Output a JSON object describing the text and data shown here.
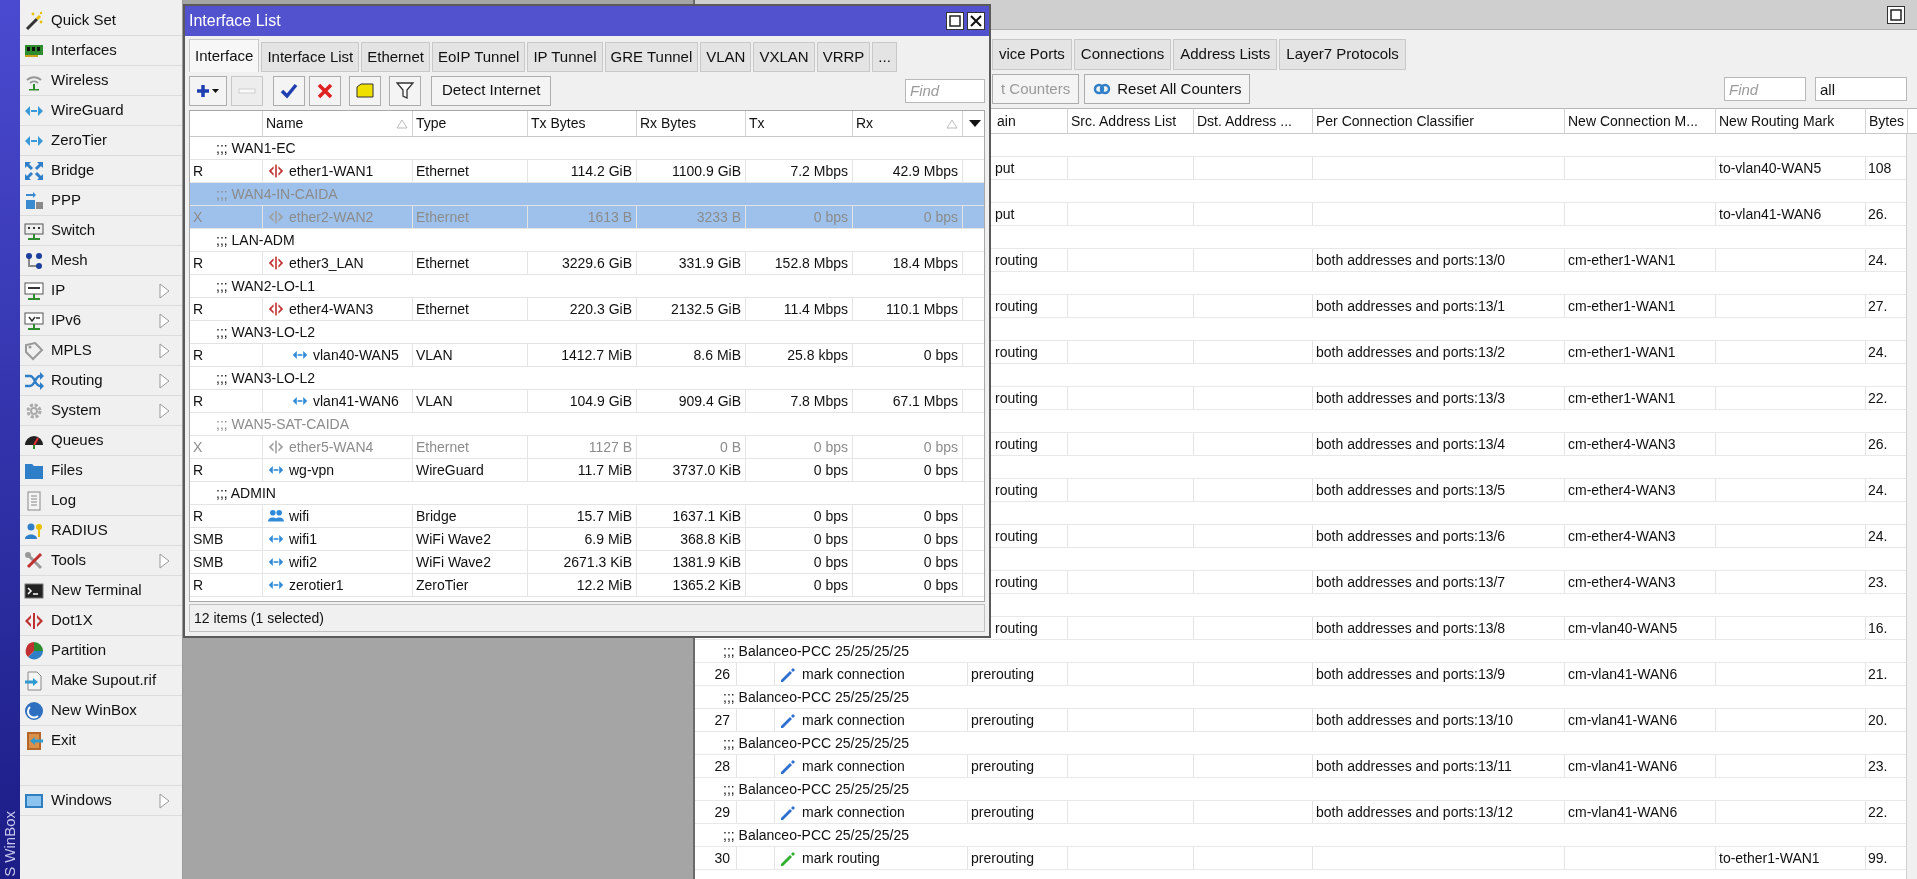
{
  "sidebar": {
    "caption": "S WinBox",
    "items": [
      {
        "label": "Quick Set",
        "submenu": false
      },
      {
        "label": "Interfaces",
        "submenu": false
      },
      {
        "label": "Wireless",
        "submenu": false
      },
      {
        "label": "WireGuard",
        "submenu": false
      },
      {
        "label": "ZeroTier",
        "submenu": false
      },
      {
        "label": "Bridge",
        "submenu": false
      },
      {
        "label": "PPP",
        "submenu": false
      },
      {
        "label": "Switch",
        "submenu": false
      },
      {
        "label": "Mesh",
        "submenu": false
      },
      {
        "label": "IP",
        "submenu": true
      },
      {
        "label": "IPv6",
        "submenu": true
      },
      {
        "label": "MPLS",
        "submenu": true
      },
      {
        "label": "Routing",
        "submenu": true
      },
      {
        "label": "System",
        "submenu": true
      },
      {
        "label": "Queues",
        "submenu": false
      },
      {
        "label": "Files",
        "submenu": false
      },
      {
        "label": "Log",
        "submenu": false
      },
      {
        "label": "RADIUS",
        "submenu": false
      },
      {
        "label": "Tools",
        "submenu": true
      },
      {
        "label": "New Terminal",
        "submenu": false
      },
      {
        "label": "Dot1X",
        "submenu": false
      },
      {
        "label": "Partition",
        "submenu": false
      },
      {
        "label": "Make Supout.rif",
        "submenu": false
      },
      {
        "label": "New WinBox",
        "submenu": false
      },
      {
        "label": "Exit",
        "submenu": false
      }
    ],
    "windows_item": {
      "label": "Windows",
      "submenu": true
    }
  },
  "rules_window": {
    "tabs": [
      {
        "label": "vice Ports",
        "selected": false
      },
      {
        "label": "Connections",
        "selected": false
      },
      {
        "label": "Address Lists",
        "selected": false
      },
      {
        "label": "Layer7 Protocols",
        "selected": false
      }
    ],
    "buttons": [
      {
        "label": "t Counters",
        "disabled": true
      },
      {
        "label": "Reset All Counters",
        "disabled": false
      }
    ],
    "find_placeholder": "Find",
    "filter_value": "all",
    "columns": [
      "ain",
      "Src. Address List",
      "Dst. Address ...",
      "Per Connection Classifier",
      "New Connection M...",
      "New Routing Mark",
      "Bytes"
    ],
    "rows": [
      {
        "kind": "comment"
      },
      {
        "kind": "rule",
        "chain": "put",
        "routing_mark": "to-vlan40-WAN5",
        "bytes": "108"
      },
      {
        "kind": "comment"
      },
      {
        "kind": "rule",
        "chain": "put",
        "routing_mark": "to-vlan41-WAN6",
        "bytes": "26."
      },
      {
        "kind": "comment"
      },
      {
        "kind": "rule",
        "chain": "routing",
        "classifier": "both addresses and ports:13/0",
        "connection_mark": "cm-ether1-WAN1",
        "bytes": "24."
      },
      {
        "kind": "comment"
      },
      {
        "kind": "rule",
        "chain": "routing",
        "classifier": "both addresses and ports:13/1",
        "connection_mark": "cm-ether1-WAN1",
        "bytes": "27."
      },
      {
        "kind": "comment"
      },
      {
        "kind": "rule",
        "chain": "routing",
        "classifier": "both addresses and ports:13/2",
        "connection_mark": "cm-ether1-WAN1",
        "bytes": "24."
      },
      {
        "kind": "comment"
      },
      {
        "kind": "rule",
        "chain": "routing",
        "classifier": "both addresses and ports:13/3",
        "connection_mark": "cm-ether1-WAN1",
        "bytes": "22."
      },
      {
        "kind": "comment"
      },
      {
        "kind": "rule",
        "chain": "routing",
        "classifier": "both addresses and ports:13/4",
        "connection_mark": "cm-ether4-WAN3",
        "bytes": "26."
      },
      {
        "kind": "comment"
      },
      {
        "kind": "rule",
        "chain": "routing",
        "classifier": "both addresses and ports:13/5",
        "connection_mark": "cm-ether4-WAN3",
        "bytes": "24."
      },
      {
        "kind": "comment"
      },
      {
        "kind": "rule",
        "chain": "routing",
        "classifier": "both addresses and ports:13/6",
        "connection_mark": "cm-ether4-WAN3",
        "bytes": "24."
      },
      {
        "kind": "comment"
      },
      {
        "kind": "rule",
        "chain": "routing",
        "classifier": "both addresses and ports:13/7",
        "connection_mark": "cm-ether4-WAN3",
        "bytes": "23."
      },
      {
        "kind": "comment"
      },
      {
        "kind": "rule",
        "chain": "routing",
        "classifier": "both addresses and ports:13/8",
        "connection_mark": "cm-vlan40-WAN5",
        "bytes": "16."
      },
      {
        "kind": "comment",
        "text": ";;; Balanceo-PCC 25/25/25/25"
      },
      {
        "kind": "rule",
        "number": "26",
        "action": "mark connection",
        "color": "#2f6fd0",
        "chain": "prerouting",
        "classifier": "both addresses and ports:13/9",
        "connection_mark": "cm-vlan41-WAN6",
        "bytes": "21."
      },
      {
        "kind": "comment",
        "text": ";;; Balanceo-PCC 25/25/25/25"
      },
      {
        "kind": "rule",
        "number": "27",
        "action": "mark connection",
        "color": "#2f6fd0",
        "chain": "prerouting",
        "classifier": "both addresses and ports:13/10",
        "connection_mark": "cm-vlan41-WAN6",
        "bytes": "20."
      },
      {
        "kind": "comment",
        "text": ";;; Balanceo-PCC 25/25/25/25"
      },
      {
        "kind": "rule",
        "number": "28",
        "action": "mark connection",
        "color": "#2f6fd0",
        "chain": "prerouting",
        "classifier": "both addresses and ports:13/11",
        "connection_mark": "cm-vlan41-WAN6",
        "bytes": "23."
      },
      {
        "kind": "comment",
        "text": ";;; Balanceo-PCC 25/25/25/25"
      },
      {
        "kind": "rule",
        "number": "29",
        "action": "mark connection",
        "color": "#2f6fd0",
        "chain": "prerouting",
        "classifier": "both addresses and ports:13/12",
        "connection_mark": "cm-vlan41-WAN6",
        "bytes": "22."
      },
      {
        "kind": "comment",
        "text": ";;; Balanceo-PCC 25/25/25/25"
      },
      {
        "kind": "rule",
        "number": "30",
        "action": "mark routing",
        "color": "#2fb02f",
        "chain": "prerouting",
        "routing_mark": "to-ether1-WAN1",
        "bytes": "99."
      }
    ]
  },
  "interface_window": {
    "title": "Interface List",
    "tabs": [
      {
        "label": "Interface",
        "selected": true
      },
      {
        "label": "Interface List",
        "selected": false
      },
      {
        "label": "Ethernet",
        "selected": false
      },
      {
        "label": "EoIP Tunnel",
        "selected": false
      },
      {
        "label": "IP Tunnel",
        "selected": false
      },
      {
        "label": "GRE Tunnel",
        "selected": false
      },
      {
        "label": "VLAN",
        "selected": false
      },
      {
        "label": "VXLAN",
        "selected": false
      },
      {
        "label": "VRRP",
        "selected": false
      },
      {
        "label": "...",
        "selected": false
      }
    ],
    "toolbar": [
      {
        "kind": "add",
        "disabled": false
      },
      {
        "kind": "remove",
        "disabled": true
      },
      {
        "kind": "enable",
        "disabled": false
      },
      {
        "kind": "disable",
        "disabled": false
      },
      {
        "kind": "comment",
        "disabled": false
      },
      {
        "kind": "filter",
        "disabled": false
      }
    ],
    "detect_button": "Detect Internet",
    "find_placeholder": "Find",
    "columns": [
      {
        "label": "Name",
        "sorted": true
      },
      {
        "label": "Type",
        "sorted": false
      },
      {
        "label": "Tx Bytes",
        "sorted": false
      },
      {
        "label": "Rx Bytes",
        "sorted": false
      },
      {
        "label": "Tx",
        "sorted": false
      },
      {
        "label": "Rx",
        "sorted": true
      }
    ],
    "items": [
      {
        "kind": "ethernet",
        "comment": ";;; WAN1-EC",
        "flags": "R",
        "name": "ether1-WAN1",
        "type": "Ethernet",
        "tx_bytes": "114.2 GiB",
        "rx_bytes": "1100.9 GiB",
        "tx": "7.2 Mbps",
        "rx": "42.9 Mbps",
        "disabled": false,
        "selected": false
      },
      {
        "kind": "ethernet",
        "comment": ";;; WAN4-IN-CAIDA",
        "flags": "X",
        "name": "ether2-WAN2",
        "type": "Ethernet",
        "tx_bytes": "1613 B",
        "rx_bytes": "3233 B",
        "tx": "0 bps",
        "rx": "0 bps",
        "disabled": true,
        "selected": true
      },
      {
        "kind": "ethernet",
        "comment": ";;; LAN-ADM",
        "flags": "R",
        "name": "ether3_LAN",
        "type": "Ethernet",
        "tx_bytes": "3229.6 GiB",
        "rx_bytes": "331.9 GiB",
        "tx": "152.8 Mbps",
        "rx": "18.4 Mbps",
        "disabled": false,
        "selected": false
      },
      {
        "kind": "ethernet",
        "comment": ";;; WAN2-LO-L1",
        "flags": "R",
        "name": "ether4-WAN3",
        "type": "Ethernet",
        "tx_bytes": "220.3 GiB",
        "rx_bytes": "2132.5 GiB",
        "tx": "11.4 Mbps",
        "rx": "110.1 Mbps",
        "disabled": false,
        "selected": false
      },
      {
        "kind": "vlan",
        "comment": ";;; WAN3-LO-L2",
        "flags": "R",
        "name": "vlan40-WAN5",
        "type": "VLAN",
        "tx_bytes": "1412.7 MiB",
        "rx_bytes": "8.6 MiB",
        "tx": "25.8 kbps",
        "rx": "0 bps",
        "disabled": false,
        "selected": false
      },
      {
        "kind": "vlan",
        "comment": ";;; WAN3-LO-L2",
        "flags": "R",
        "name": "vlan41-WAN6",
        "type": "VLAN",
        "tx_bytes": "104.9 GiB",
        "rx_bytes": "909.4 GiB",
        "tx": "7.8 Mbps",
        "rx": "67.1 Mbps",
        "disabled": false,
        "selected": false
      },
      {
        "kind": "ethernet",
        "comment": ";;; WAN5-SAT-CAIDA",
        "flags": "X",
        "name": "ether5-WAN4",
        "type": "Ethernet",
        "tx_bytes": "1127 B",
        "rx_bytes": "0 B",
        "tx": "0 bps",
        "rx": "0 bps",
        "disabled": true,
        "selected": false
      },
      {
        "kind": "tunnel",
        "flags": "R",
        "name": "wg-vpn",
        "type": "WireGuard",
        "tx_bytes": "11.7 MiB",
        "rx_bytes": "3737.0 KiB",
        "tx": "0 bps",
        "rx": "0 bps",
        "disabled": false,
        "selected": false
      },
      {
        "kind": "bridge",
        "comment": ";;; ADMIN",
        "flags": "R",
        "name": "wifi",
        "type": "Bridge",
        "tx_bytes": "15.7 MiB",
        "rx_bytes": "1637.1 KiB",
        "tx": "0 bps",
        "rx": "0 bps",
        "disabled": false,
        "selected": false
      },
      {
        "kind": "tunnel",
        "flags": "SMB",
        "name": "wifi1",
        "type": "WiFi Wave2",
        "tx_bytes": "6.9 MiB",
        "rx_bytes": "368.8 KiB",
        "tx": "0 bps",
        "rx": "0 bps",
        "disabled": false,
        "selected": false
      },
      {
        "kind": "tunnel",
        "flags": "SMB",
        "name": "wifi2",
        "type": "WiFi Wave2",
        "tx_bytes": "2671.3 KiB",
        "rx_bytes": "1381.9 KiB",
        "tx": "0 bps",
        "rx": "0 bps",
        "disabled": false,
        "selected": false
      },
      {
        "kind": "tunnel",
        "flags": "R",
        "name": "zerotier1",
        "type": "ZeroTier",
        "tx_bytes": "12.2 MiB",
        "rx_bytes": "1365.2 KiB",
        "tx": "0 bps",
        "rx": "0 bps",
        "disabled": false,
        "selected": false
      }
    ],
    "status": "12 items (1 selected)"
  }
}
